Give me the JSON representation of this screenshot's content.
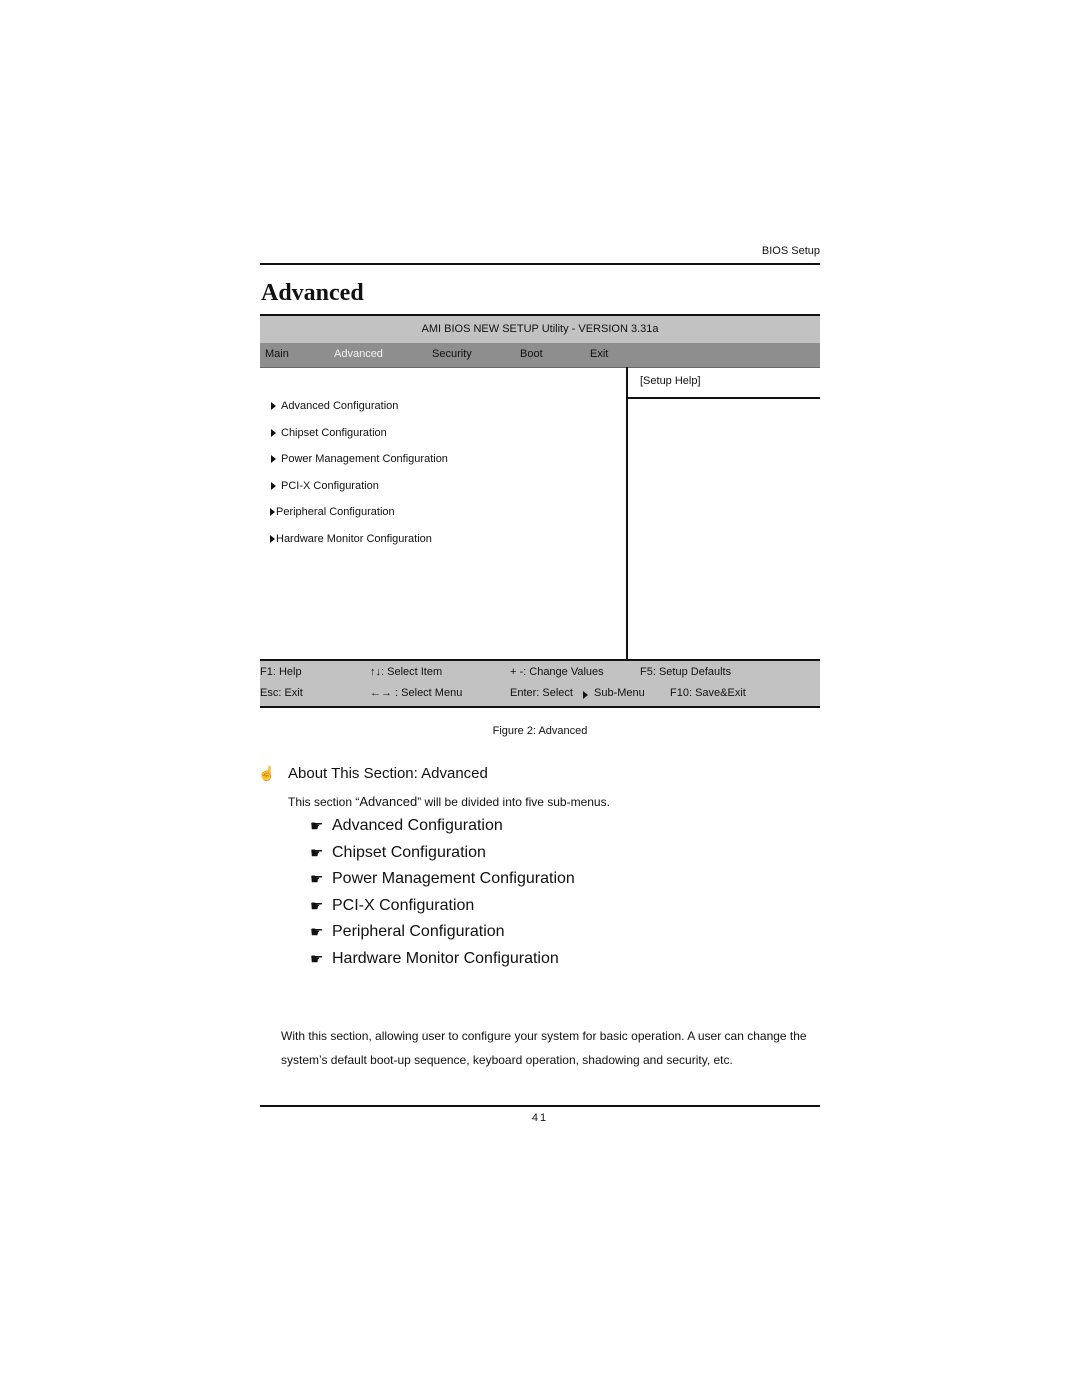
{
  "page": {
    "running_head": "BIOS Setup",
    "title": "Advanced",
    "page_number": "41"
  },
  "bios": {
    "header": "AMI BIOS NEW SETUP Utility - VERSION 3.31a",
    "tabs": [
      {
        "label": "Main",
        "active": false
      },
      {
        "label": "Advanced",
        "active": true
      },
      {
        "label": "Security",
        "active": false
      },
      {
        "label": "Boot",
        "active": false
      },
      {
        "label": "Exit",
        "active": false
      }
    ],
    "help_label": "[Setup Help]",
    "menu_items": [
      {
        "label": "Advanced Configuration",
        "icon": "triangle-right-icon"
      },
      {
        "label": "Chipset Configuration",
        "icon": "triangle-right-icon"
      },
      {
        "label": "Power Management Configuration",
        "icon": "triangle-right-icon"
      },
      {
        "label": "PCI-X Configuration",
        "icon": "triangle-right-icon"
      },
      {
        "label": "Peripheral Configuration",
        "icon": "triangle-right-icon"
      },
      {
        "label": "Hardware Monitor Configuration",
        "icon": "triangle-right-icon"
      }
    ],
    "footer": {
      "row1": [
        "F1: Help",
        "↑↓: Select Item",
        "+ -: Change Values",
        "F5: Setup Defaults"
      ],
      "row2": [
        "Esc: Exit",
        "←→ : Select Menu",
        "Enter: Select",
        "Sub-Menu",
        "F10: Save&Exit"
      ]
    },
    "colors": {
      "header_bg": "#c2c2c2",
      "tabbar_bg": "#8e8e8e",
      "active_tab_text": "#f2f2f2"
    }
  },
  "caption": "Figure 2: Advanced",
  "about": {
    "icon": "pointing-hand-up-icon",
    "heading": "About This Section: Advanced",
    "intro_prefix": "This section “",
    "intro_quoted": "Advanced",
    "intro_suffix": "”  will be divided into five sub-menus.",
    "sub_menus": [
      "Advanced Configuration",
      "Chipset Configuration",
      "Power Management Configuration",
      "PCI-X Configuration",
      "Peripheral Configuration",
      "Hardware Monitor Configuration"
    ],
    "paragraph": "With this section, allowing user to configure your system for basic operation. A user can change the system’s default boot-up sequence, keyboard operation, shadowing and security, etc."
  }
}
